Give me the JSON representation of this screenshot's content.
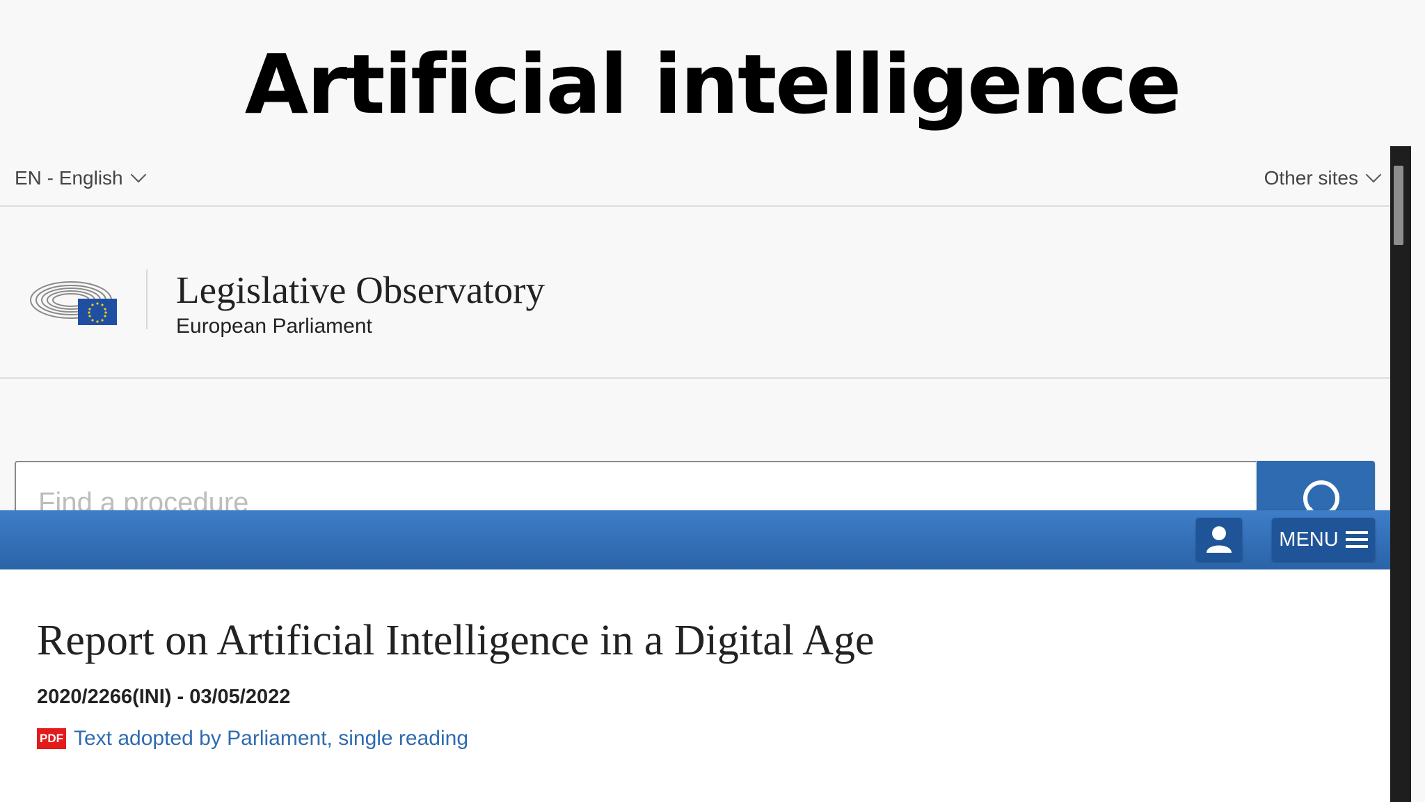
{
  "slide": {
    "title": "Artificial intelligence"
  },
  "topbar": {
    "language": "EN - English",
    "other_sites": "Other sites"
  },
  "header": {
    "title": "Legislative Observatory",
    "subtitle": "European Parliament"
  },
  "search": {
    "placeholder": "Find a procedure",
    "value": ""
  },
  "navbar": {
    "menu_label": "MENU"
  },
  "report": {
    "title": "Report on Artificial Intelligence in a Digital Age",
    "reference": "2020/2266(INI) - 03/05/2022",
    "pdf_badge": "PDF",
    "document_link": "Text adopted by Parliament, single reading"
  },
  "colors": {
    "accent": "#2f6bb0",
    "navbar": "#3e7ec8",
    "pdf": "#e31b1b",
    "eu_flag": "#1f4fa3"
  },
  "icons": [
    "eu-parliament-logo-icon",
    "search-icon",
    "user-icon",
    "hamburger-icon",
    "chevron-down-icon",
    "pdf-icon"
  ]
}
